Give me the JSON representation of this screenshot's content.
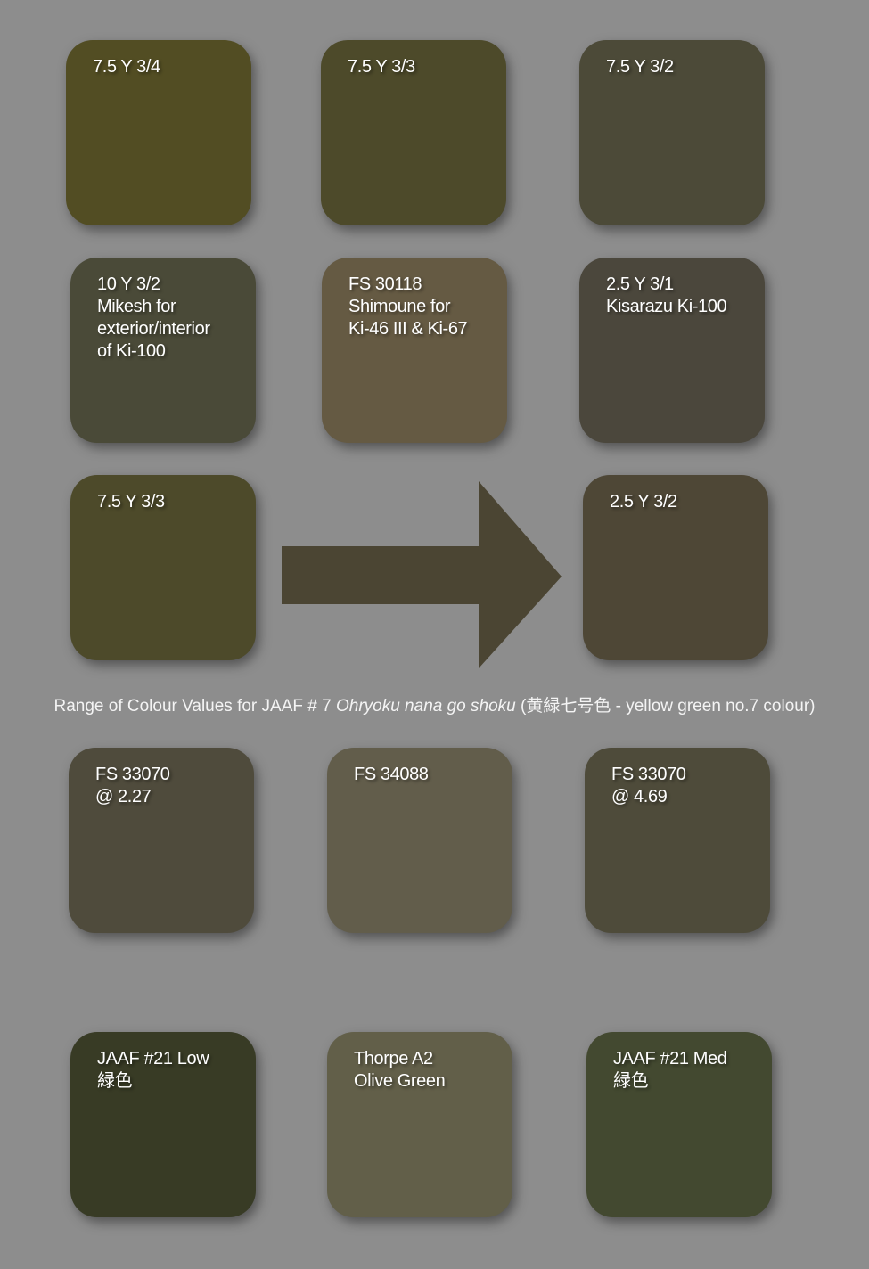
{
  "colors": {
    "background": "#8d8d8d",
    "arrow": "#4b4533",
    "caption_text": "#f4f4f4",
    "label_text": "#ffffff"
  },
  "swatches": {
    "r1c1": {
      "label": "7.5 Y 3/4",
      "color": "#524d23"
    },
    "r1c2": {
      "label": "7.5 Y 3/3",
      "color": "#4d4a2a"
    },
    "r1c3": {
      "label": "7.5 Y 3/2",
      "color": "#4c4a38"
    },
    "r2c1": {
      "label": "10 Y 3/2\nMikesh for\nexterior/interior\nof Ki-100",
      "color": "#4a4a38"
    },
    "r2c2": {
      "label": "FS 30118\nShimoune for\nKi-46 III & Ki-67",
      "color": "#655a43"
    },
    "r2c3": {
      "label": "2.5 Y 3/1\nKisarazu Ki-100",
      "color": "#4b473c"
    },
    "r3c1": {
      "label": "7.5 Y 3/3",
      "color": "#4d4a2a"
    },
    "r3c3": {
      "label": "2.5 Y 3/2",
      "color": "#4e4736"
    },
    "r4c1": {
      "label": "FS 33070\n@ 2.27",
      "color": "#4f4b3c"
    },
    "r4c2": {
      "label": "FS 34088",
      "color": "#625d4b"
    },
    "r4c3": {
      "label": "FS 33070\n@ 4.69",
      "color": "#4e4b3a"
    },
    "r5c1": {
      "label": "JAAF #21 Low\n緑色",
      "color": "#383b25"
    },
    "r5c2": {
      "label": "Thorpe A2\nOlive Green",
      "color": "#625f49"
    },
    "r5c3": {
      "label": "JAAF #21 Med\n緑色",
      "color": "#434930"
    }
  },
  "caption": {
    "prefix": "Range of Colour Values for JAAF # 7 ",
    "italic": "Ohryoku nana go shoku",
    "suffix": " (黄緑七号色 - yellow green no.7 colour)"
  }
}
